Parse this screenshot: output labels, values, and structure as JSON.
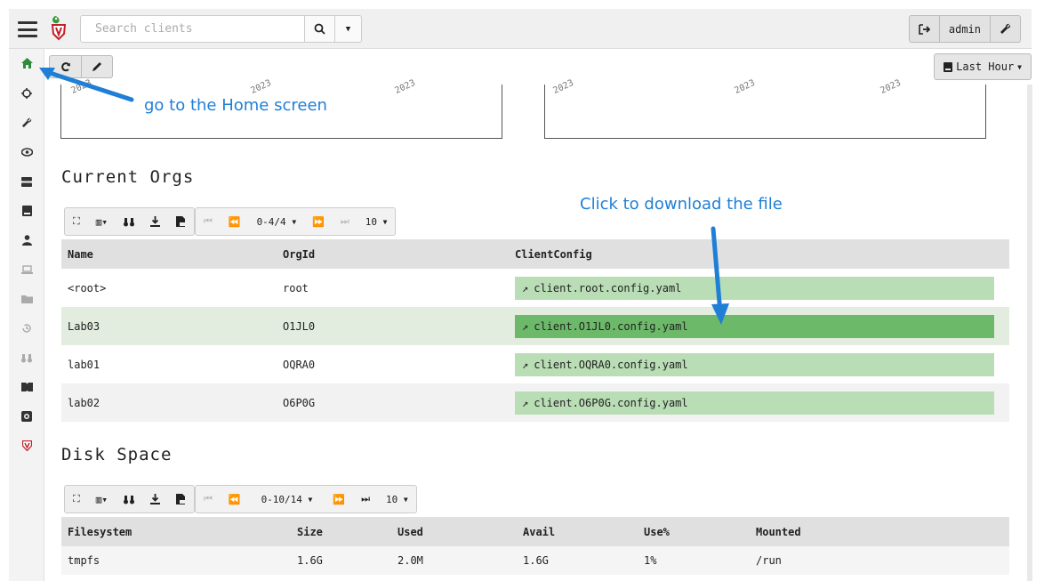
{
  "header": {
    "search_placeholder": "Search clients",
    "user_label": "admin"
  },
  "toolbar": {
    "time_range_label": "Last Hour"
  },
  "graphs": {
    "left_labels": [
      "2023",
      "2023",
      "2023"
    ],
    "right_labels": [
      "2023",
      "2023",
      "2023"
    ]
  },
  "orgs": {
    "title": "Current Orgs",
    "pager_label": "0-4/4",
    "page_size": "10",
    "columns": [
      "Name",
      "OrgId",
      "ClientConfig"
    ],
    "rows": [
      {
        "name": "<root>",
        "org_id": "root",
        "config": "client.root.config.yaml"
      },
      {
        "name": "Lab03",
        "org_id": "O1JL0",
        "config": "client.O1JL0.config.yaml"
      },
      {
        "name": "lab01",
        "org_id": "OQRA0",
        "config": "client.OQRA0.config.yaml"
      },
      {
        "name": "lab02",
        "org_id": "O6P0G",
        "config": "client.O6P0G.config.yaml"
      }
    ]
  },
  "disk": {
    "title": "Disk Space",
    "pager_label": "0-10/14",
    "page_size": "10",
    "columns": [
      "Filesystem",
      "Size",
      "Used",
      "Avail",
      "Use%",
      "Mounted"
    ],
    "rows": [
      {
        "filesystem": "tmpfs",
        "size": "1.6G",
        "used": "2.0M",
        "avail": "1.6G",
        "use_pct": "1%",
        "mounted": "/run"
      }
    ]
  },
  "annotations": {
    "home_hint": "go to the Home screen",
    "download_hint": "Click to download the file"
  },
  "colors": {
    "config_link": "#b9ddb5",
    "config_link_active": "#6db96a",
    "annotation": "#1f7fd6"
  }
}
